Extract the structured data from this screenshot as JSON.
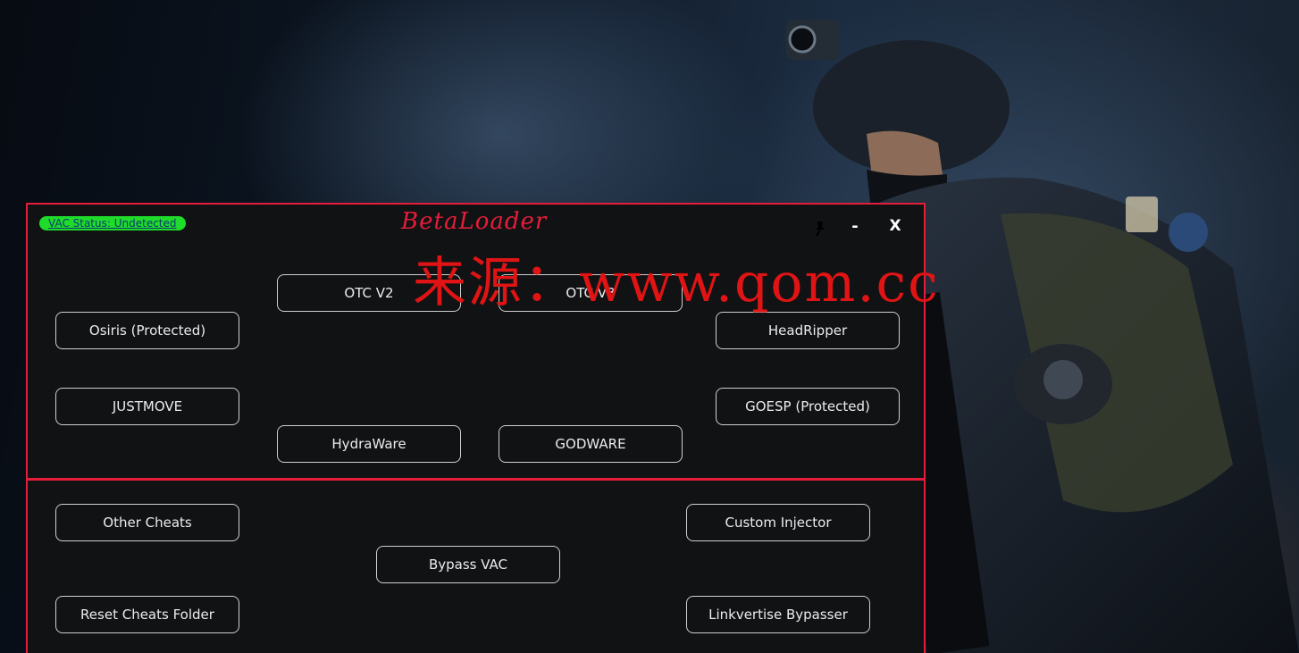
{
  "window": {
    "title": "BetaLoader",
    "vac_status": "VAC Status: Undetected",
    "minimize_label": "-",
    "close_label": "X",
    "colors": {
      "accent": "#e51d3a",
      "badge": "#1fdc2b",
      "panel": "#111214"
    }
  },
  "cheats": {
    "otc_v2": "OTC V2",
    "otc_v3": "OTC V3",
    "osiris": "Osiris (Protected)",
    "headripper": "HeadRipper",
    "justmove": "JUSTMOVE",
    "goesp": "GOESP (Protected)",
    "hydraware": "HydraWare",
    "godware": "GODWARE"
  },
  "tools": {
    "other_cheats": "Other Cheats",
    "custom_injector": "Custom Injector",
    "bypass_vac": "Bypass VAC",
    "reset_cheats_folder": "Reset Cheats Folder",
    "linkvertise_bypasser": "Linkvertise Bypasser"
  },
  "watermark": "来源：www.qom.cc",
  "icons": {
    "pin": "pin-icon"
  }
}
